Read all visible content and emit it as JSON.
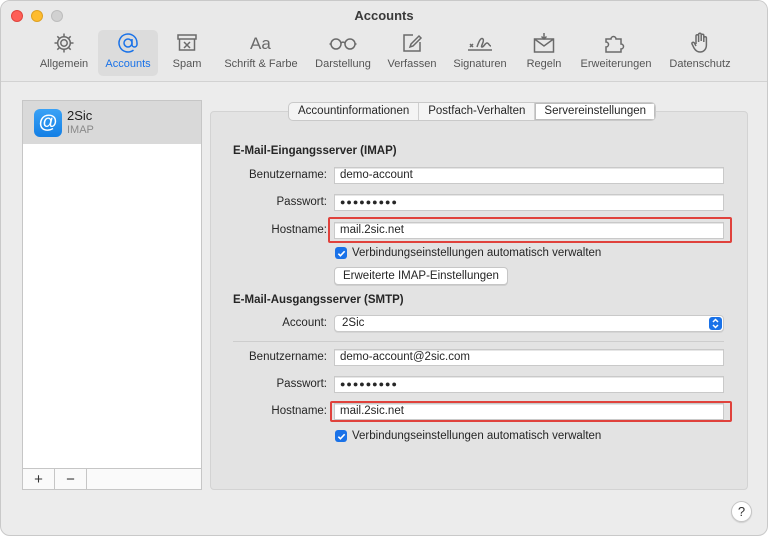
{
  "window": {
    "title": "Accounts"
  },
  "toolbar": {
    "items": [
      {
        "label": "Allgemein",
        "icon": "gear-icon"
      },
      {
        "label": "Accounts",
        "icon": "at-icon"
      },
      {
        "label": "Spam",
        "icon": "junk-tray-icon"
      },
      {
        "label": "Schrift & Farbe",
        "icon": "font-icon"
      },
      {
        "label": "Darstellung",
        "icon": "glasses-icon"
      },
      {
        "label": "Verfassen",
        "icon": "compose-icon"
      },
      {
        "label": "Signaturen",
        "icon": "signature-icon"
      },
      {
        "label": "Regeln",
        "icon": "rules-envelope-icon"
      },
      {
        "label": "Erweiterungen",
        "icon": "puzzle-icon"
      },
      {
        "label": "Datenschutz",
        "icon": "hand-icon"
      }
    ],
    "active": "Accounts"
  },
  "sidebar": {
    "accounts": [
      {
        "name": "2Sic",
        "type": "IMAP"
      }
    ],
    "add_label": "+",
    "remove_label": "−"
  },
  "tabs": [
    {
      "label": "Accountinformationen"
    },
    {
      "label": "Postfach-Verhalten"
    },
    {
      "label": "Servereinstellungen"
    }
  ],
  "selected_tab": "Servereinstellungen",
  "incoming": {
    "title": "E-Mail-Eingangsserver (IMAP)",
    "username_label": "Benutzername:",
    "username": "demo-account",
    "password_label": "Passwort:",
    "password": "●●●●●●●●●",
    "hostname_label": "Hostname:",
    "hostname": "mail.2sic.net",
    "auto_label": "Verbindungseinstellungen automatisch verwalten",
    "auto_checked": true,
    "advanced_button": "Erweiterte IMAP-Einstellungen"
  },
  "outgoing": {
    "title": "E-Mail-Ausgangsserver (SMTP)",
    "account_label": "Account:",
    "account": "2Sic",
    "username_label": "Benutzername:",
    "username": "demo-account@2sic.com",
    "password_label": "Passwort:",
    "password": "●●●●●●●●●",
    "hostname_label": "Hostname:",
    "hostname": "mail.2sic.net",
    "auto_label": "Verbindungseinstellungen automatisch verwalten",
    "auto_checked": true
  },
  "help_label": "?",
  "colors": {
    "accent": "#1a72e8",
    "highlight": "#e0423c"
  }
}
